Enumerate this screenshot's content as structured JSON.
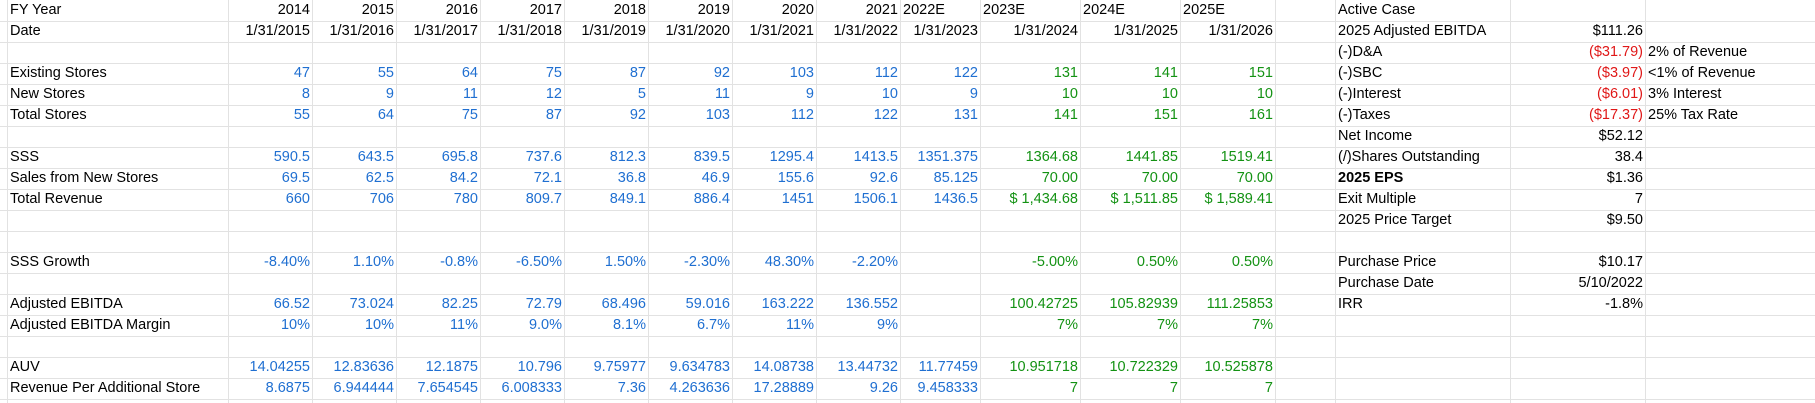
{
  "colors": {
    "text": "#000000",
    "blue": "#1f6fd1",
    "green": "#139213",
    "red": "#e01818",
    "grid": "#e2e2e2"
  },
  "left": {
    "headers": {
      "fy_label": "FY Year",
      "date_label": "Date",
      "years": [
        "2014",
        "2015",
        "2016",
        "2017",
        "2018",
        "2019",
        "2020",
        "2021",
        "2022E",
        "2023E",
        "2024E",
        "2025E"
      ],
      "dates": [
        "1/31/2015",
        "1/31/2016",
        "1/31/2017",
        "1/31/2018",
        "1/31/2019",
        "1/31/2020",
        "1/31/2021",
        "1/31/2022",
        "1/31/2023",
        "1/31/2024",
        "1/31/2025",
        "1/31/2026"
      ]
    },
    "rows": [
      {
        "row": 3,
        "label": "Existing Stores",
        "values": [
          "47",
          "55",
          "64",
          "75",
          "87",
          "92",
          "103",
          "112",
          "122",
          "131",
          "141",
          "151"
        ]
      },
      {
        "row": 4,
        "label": "New Stores",
        "values": [
          "8",
          "9",
          "11",
          "12",
          "5",
          "11",
          "9",
          "10",
          "9",
          "10",
          "10",
          "10"
        ]
      },
      {
        "row": 5,
        "label": "Total Stores",
        "values": [
          "55",
          "64",
          "75",
          "87",
          "92",
          "103",
          "112",
          "122",
          "131",
          "141",
          "151",
          "161"
        ]
      },
      {
        "row": 7,
        "label": "SSS",
        "values": [
          "590.5",
          "643.5",
          "695.8",
          "737.6",
          "812.3",
          "839.5",
          "1295.4",
          "1413.5",
          "1351.375",
          "1364.68",
          "1441.85",
          "1519.41"
        ]
      },
      {
        "row": 8,
        "label": "Sales from New Stores",
        "values": [
          "69.5",
          "62.5",
          "84.2",
          "72.1",
          "36.8",
          "46.9",
          "155.6",
          "92.6",
          "85.125",
          "70.00",
          "70.00",
          "70.00"
        ]
      },
      {
        "row": 9,
        "label": "Total Revenue",
        "values": [
          "660",
          "706",
          "780",
          "809.7",
          "849.1",
          "886.4",
          "1451",
          "1506.1",
          "1436.5",
          "$ 1,434.68",
          "$ 1,511.85",
          "$ 1,589.41"
        ]
      },
      {
        "row": 12,
        "label": "SSS Growth",
        "values": [
          "-8.40%",
          "1.10%",
          "-0.8%",
          "-6.50%",
          "1.50%",
          "-2.30%",
          "48.30%",
          "-2.20%",
          "",
          "-5.00%",
          "0.50%",
          "0.50%"
        ]
      },
      {
        "row": 14,
        "label": "Adjusted EBITDA",
        "values": [
          "66.52",
          "73.024",
          "82.25",
          "72.79",
          "68.496",
          "59.016",
          "163.222",
          "136.552",
          "",
          "100.42725",
          "105.82939",
          "111.25853"
        ]
      },
      {
        "row": 15,
        "label": "Adjusted EBITDA Margin",
        "values": [
          "10%",
          "10%",
          "11%",
          "9.0%",
          "8.1%",
          "6.7%",
          "11%",
          "9%",
          "",
          "7%",
          "7%",
          "7%"
        ]
      },
      {
        "row": 17,
        "label": "AUV",
        "values": [
          "14.04255",
          "12.83636",
          "12.1875",
          "10.796",
          "9.75977",
          "9.634783",
          "14.08738",
          "13.44732",
          "11.77459",
          "10.951718",
          "10.722329",
          "10.525878"
        ]
      },
      {
        "row": 18,
        "label": "Revenue Per Additional Store",
        "values": [
          "8.6875",
          "6.944444",
          "7.654545",
          "6.008333",
          "7.36",
          "4.263636",
          "17.28889",
          "9.26",
          "9.458333",
          "7",
          "7",
          "7"
        ]
      }
    ]
  },
  "right": {
    "rows": [
      {
        "row": 0,
        "label": "Active Case",
        "value": "",
        "note": "",
        "tone": "black"
      },
      {
        "row": 1,
        "label": "2025 Adjusted EBITDA",
        "value": "$111.26",
        "note": "",
        "tone": "black"
      },
      {
        "row": 2,
        "label": "(-)D&A",
        "value": "($31.79)",
        "note": "2% of Revenue",
        "tone": "red"
      },
      {
        "row": 3,
        "label": "(-)SBC",
        "value": "($3.97)",
        "note": "<1% of  Revenue",
        "tone": "red"
      },
      {
        "row": 4,
        "label": "(-)Interest",
        "value": "($6.01)",
        "note": "3% Interest",
        "tone": "red"
      },
      {
        "row": 5,
        "label": "(-)Taxes",
        "value": "($17.37)",
        "note": "25% Tax Rate",
        "tone": "red"
      },
      {
        "row": 6,
        "label": "Net Income",
        "value": "$52.12",
        "note": "",
        "tone": "black"
      },
      {
        "row": 7,
        "label": "(/)Shares Outstanding",
        "value": "38.4",
        "note": "",
        "tone": "black"
      },
      {
        "row": 8,
        "label": "2025 EPS",
        "value": "$1.36",
        "note": "",
        "tone": "black",
        "bold": true
      },
      {
        "row": 9,
        "label": "Exit Multiple",
        "value": "7",
        "note": "",
        "tone": "black"
      },
      {
        "row": 10,
        "label": "2025 Price Target",
        "value": "$9.50",
        "note": "",
        "tone": "black"
      },
      {
        "row": 12,
        "label": "Purchase Price",
        "value": "$10.17",
        "note": "",
        "tone": "black"
      },
      {
        "row": 13,
        "label": "Purchase Date",
        "value": "5/10/2022",
        "note": "",
        "tone": "black"
      },
      {
        "row": 14,
        "label": "IRR",
        "value": "-1.8%",
        "note": "",
        "tone": "black"
      }
    ]
  }
}
